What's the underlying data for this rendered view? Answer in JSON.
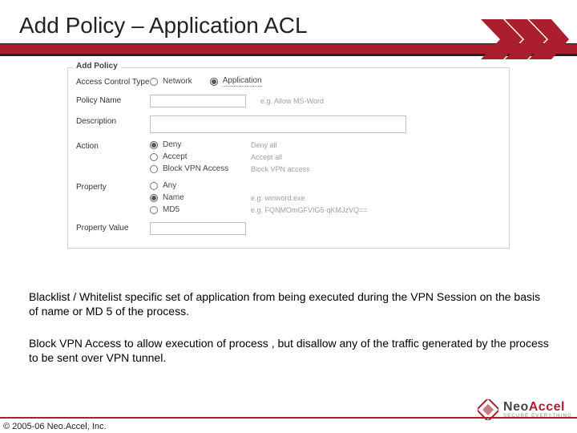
{
  "header": {
    "title": "Add Policy – Application ACL"
  },
  "form": {
    "panel_title": "Add Policy",
    "access_control": {
      "label": "Access Control Type",
      "network": "Network",
      "application": "Application",
      "selected": "application"
    },
    "policy_name": {
      "label": "Policy Name",
      "value": "",
      "hint": "e.g. Allow MS-Word"
    },
    "description": {
      "label": "Description",
      "value": ""
    },
    "action": {
      "label": "Action",
      "options": [
        {
          "label": "Deny",
          "hint": "Deny all"
        },
        {
          "label": "Accept",
          "hint": "Accept all"
        },
        {
          "label": "Block VPN Access",
          "hint": "Block VPN access"
        }
      ],
      "selected": 0
    },
    "property": {
      "label": "Property",
      "options": [
        {
          "label": "Any",
          "hint": ""
        },
        {
          "label": "Name",
          "hint": "e.g. winword.exe"
        },
        {
          "label": "MD5",
          "hint": "e.g. FQNMOmGFVIG5·qKMJzVQ=="
        }
      ],
      "selected": 1
    },
    "property_value": {
      "label": "Property Value",
      "value": ""
    }
  },
  "paragraphs": {
    "p1": "Blacklist / Whitelist specific set of application from being executed during the VPN Session on the basis of name or MD 5 of the process.",
    "p2": "Block VPN Access to allow execution of process , but disallow any of the traffic generated by the process to be sent over VPN tunnel."
  },
  "footer": {
    "copyright": "© 2005-06 Neo.Accel, Inc.",
    "logo": {
      "neo": "Neo",
      "accel": "Accel",
      "tagline": "SECURE EVERYTHING"
    }
  }
}
